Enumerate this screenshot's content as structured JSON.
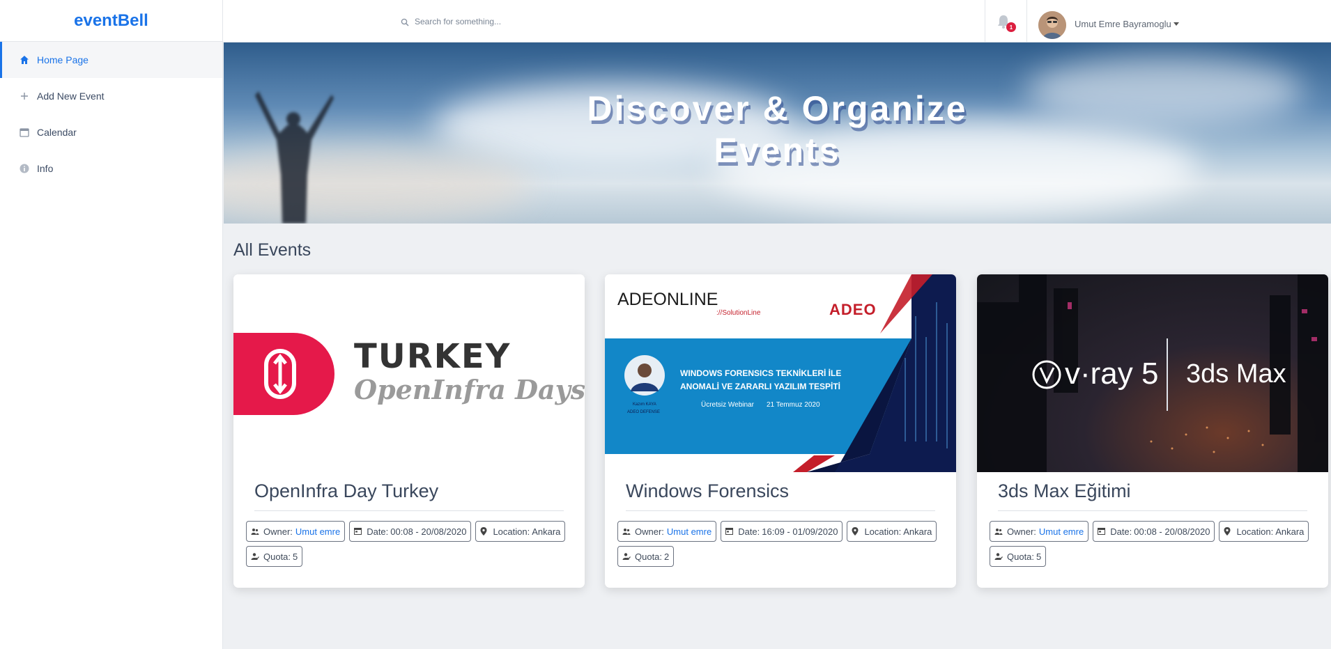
{
  "app": {
    "brand": "eventBell"
  },
  "sidebar": {
    "items": [
      {
        "label": "Home Page",
        "icon": "home-icon",
        "active": true
      },
      {
        "label": "Add New Event",
        "icon": "plus-icon",
        "active": false
      },
      {
        "label": "Calendar",
        "icon": "calendar-icon",
        "active": false
      },
      {
        "label": "Info",
        "icon": "info-icon",
        "active": false
      }
    ]
  },
  "topbar": {
    "search_placeholder": "Search for something...",
    "notification_count": "1",
    "user_name": "Umut Emre Bayramoglu"
  },
  "hero": {
    "title_line1": "Discover & Organize",
    "title_line2": "Events"
  },
  "main": {
    "section_title": "All Events",
    "events": [
      {
        "title": "OpenInfra Day Turkey",
        "owner_label": "Owner:",
        "owner": "Umut emre",
        "date_label": "Date:",
        "date": "00:08 - 20/08/2020",
        "location_label": "Location:",
        "location": "Ankara",
        "quota_label": "Quota:",
        "quota": "5",
        "banner": {
          "line1": "TURKEY",
          "line2": "OpenInfra Days"
        }
      },
      {
        "title": "Windows Forensics",
        "owner_label": "Owner:",
        "owner": "Umut emre",
        "date_label": "Date:",
        "date": "16:09 - 01/09/2020",
        "location_label": "Location:",
        "location": "Ankara",
        "quota_label": "Quota:",
        "quota": "2",
        "banner": {
          "brand_left": "ADEONLINE",
          "brand_sub": "://SolutionLine",
          "brand_right": "ADEO",
          "headline1": "WINDOWS FORENSICS TEKNİKLERİ İLE",
          "headline2": "ANOMALİ VE ZARARLI YAZILIM TESPİTİ",
          "webinar": "Ücretsiz Webinar",
          "date": "21 Temmuz 2020",
          "speaker": "Kazım KAYA",
          "speaker_org": "ADEO DEFENSE"
        }
      },
      {
        "title": "3ds Max Eğitimi",
        "owner_label": "Owner:",
        "owner": "Umut emre",
        "date_label": "Date:",
        "date": "00:08 - 20/08/2020",
        "location_label": "Location:",
        "location": "Ankara",
        "quota_label": "Quota:",
        "quota": "5",
        "banner": {
          "left": "v·ray 5",
          "right": "3ds Max"
        }
      }
    ]
  },
  "colors": {
    "accent": "#1a73e8",
    "badge": "#dc1f3f",
    "openinfra_red": "#e5194a",
    "adeo_blue": "#1287c8",
    "adeo_navy": "#0d1b4f"
  }
}
